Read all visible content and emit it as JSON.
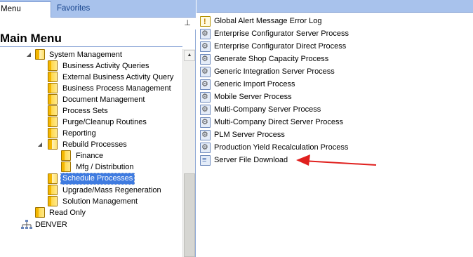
{
  "tabs": {
    "menu_groups": "Menu Groups",
    "favorites": "Favorites"
  },
  "pin_icon": "pin-icon",
  "left_panel": {
    "title": "Main Menu"
  },
  "tree": [
    {
      "label": "System Management",
      "expander": "◢"
    },
    {
      "label": "Business Activity Queries"
    },
    {
      "label": "External Business Activity Query"
    },
    {
      "label": "Business Process Management"
    },
    {
      "label": "Document Management"
    },
    {
      "label": "Process Sets"
    },
    {
      "label": "Purge/Cleanup Routines"
    },
    {
      "label": "Reporting"
    },
    {
      "label": "Rebuild Processes",
      "expander": "◢"
    },
    {
      "label": "Finance"
    },
    {
      "label": "Mfg / Distribution"
    },
    {
      "label": "Schedule Processes",
      "selected": true
    },
    {
      "label": "Upgrade/Mass Regeneration"
    },
    {
      "label": "Solution Management"
    },
    {
      "label": "Read Only"
    },
    {
      "label": "DENVER"
    }
  ],
  "processes": [
    {
      "label": "Global Alert Message Error Log",
      "icon": "alert-icon"
    },
    {
      "label": "Enterprise Configurator Server Process",
      "icon": "process-icon"
    },
    {
      "label": "Enterprise Configurator Direct Process",
      "icon": "process-icon"
    },
    {
      "label": "Generate Shop Capacity Process",
      "icon": "process-icon"
    },
    {
      "label": "Generic Integration Server Process",
      "icon": "process-icon"
    },
    {
      "label": "Generic Import Process",
      "icon": "process-icon"
    },
    {
      "label": "Mobile Server Process",
      "icon": "process-icon"
    },
    {
      "label": "Multi-Company Server Process",
      "icon": "process-icon"
    },
    {
      "label": "Multi-Company Direct Server Process",
      "icon": "process-icon"
    },
    {
      "label": "PLM Server Process",
      "icon": "process-icon"
    },
    {
      "label": "Production Yield Recalculation Process",
      "icon": "process-icon"
    },
    {
      "label": "Server File Download",
      "icon": "document-icon"
    }
  ],
  "annotation": {
    "color": "#e0201e"
  }
}
